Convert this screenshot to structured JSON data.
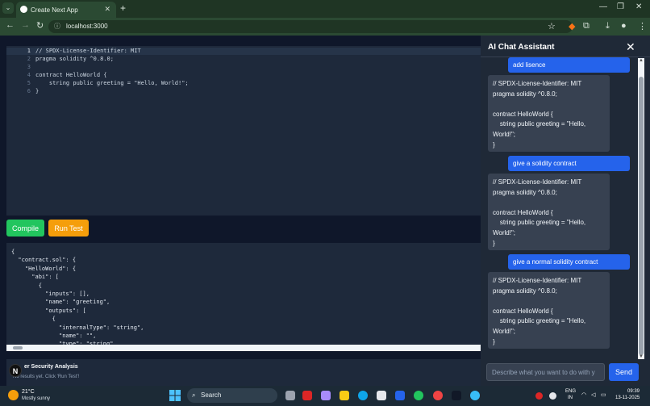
{
  "browser": {
    "tab_title": "Create Next App",
    "url": "localhost:3000"
  },
  "editor": {
    "line_numbers": [
      "1",
      "2",
      "3",
      "4",
      "5",
      "6"
    ],
    "lines": [
      "// SPDX-License-Identifier: MIT",
      "pragma solidity ^0.8.0;",
      "",
      "contract HelloWorld {",
      "    string public greeting = \"Hello, World!\";",
      "}"
    ]
  },
  "toolbar": {
    "compile_label": "Compile",
    "run_test_label": "Run Test"
  },
  "output": {
    "text": "{\n  \"contract.sol\": {\n    \"HelloWorld\": {\n      \"abi\": [\n        {\n          \"inputs\": [],\n          \"name\": \"greeting\",\n          \"outputs\": [\n            {\n              \"internalType\": \"string\",\n              \"name\": \"\",\n              \"type\": \"string\""
  },
  "security": {
    "title": "er Security Analysis",
    "subtitle": "No results yet. Click 'Run Test'!"
  },
  "chat": {
    "title": "AI Chat Assistant",
    "messages": [
      {
        "role": "user",
        "text": "add lisence"
      },
      {
        "role": "assistant",
        "text": "// SPDX-License-Identifier: MIT\npragma solidity ^0.8.0;\n\ncontract HelloWorld {\n    string public greeting = \"Hello,\nWorld!\";\n}"
      },
      {
        "role": "user",
        "text": "give a solidity contract"
      },
      {
        "role": "assistant",
        "text": "// SPDX-License-Identifier: MIT\npragma solidity ^0.8.0;\n\ncontract HelloWorld {\n    string public greeting = \"Hello,\nWorld!\";\n}"
      },
      {
        "role": "user",
        "text": "give a normal solidity contract"
      },
      {
        "role": "assistant",
        "text": "// SPDX-License-Identifier: MIT\npragma solidity ^0.8.0;\n\ncontract HelloWorld {\n    string public greeting = \"Hello,\nWorld!\";\n}"
      }
    ],
    "input_placeholder": "Describe what you want to do with y",
    "send_label": "Send"
  },
  "taskbar": {
    "temperature": "21°C",
    "weather": "Mostly sunny",
    "search_placeholder": "Search",
    "lang_1": "ENG",
    "lang_2": "IN",
    "time": "09:39",
    "date": "13-11-2025"
  },
  "colors": {
    "compile": "#22c55e",
    "run_test": "#f59e0b",
    "send": "#2563eb",
    "user_bubble": "#2563eb",
    "assistant_bubble": "#374151"
  }
}
